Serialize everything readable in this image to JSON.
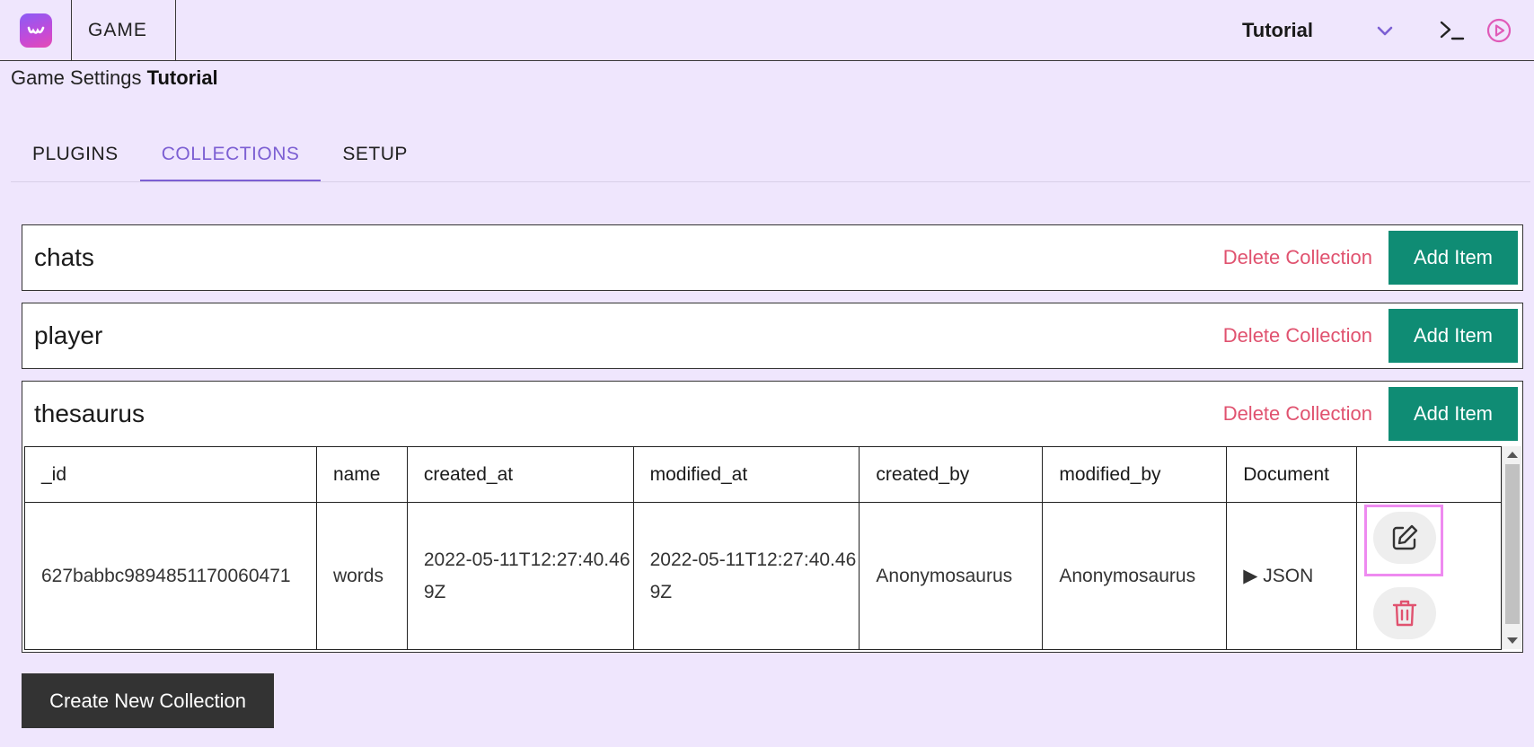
{
  "topbar": {
    "app_label": "GAME",
    "selected_game": "Tutorial"
  },
  "breadcrumb": {
    "prefix": "Game Settings",
    "current": "Tutorial"
  },
  "tabs": [
    {
      "label": "PLUGINS",
      "active": false
    },
    {
      "label": "COLLECTIONS",
      "active": true
    },
    {
      "label": "SETUP",
      "active": false
    }
  ],
  "collections": [
    {
      "name": "chats",
      "delete_label": "Delete Collection",
      "add_label": "Add Item"
    },
    {
      "name": "player",
      "delete_label": "Delete Collection",
      "add_label": "Add Item"
    },
    {
      "name": "thesaurus",
      "delete_label": "Delete Collection",
      "add_label": "Add Item"
    }
  ],
  "table": {
    "headers": [
      "_id",
      "name",
      "created_at",
      "modified_at",
      "created_by",
      "modified_by",
      "Document",
      ""
    ],
    "rows": [
      {
        "_id": "627babbc9894851170060471",
        "name": "words",
        "created_at": "2022-05-11T12:27:40.469Z",
        "modified_at": "2022-05-11T12:27:40.469Z",
        "created_by": "Anonymosaurus",
        "modified_by": "Anonymosaurus",
        "document": "▶ JSON"
      }
    ]
  },
  "create_button_label": "Create New Collection",
  "colors": {
    "background": "#efe6fd",
    "accent": "#7c5fd3",
    "add_button": "#0f8c74",
    "delete_text": "#e0526f",
    "highlight": "#ee8af0"
  },
  "icons": [
    "app-logo-icon",
    "chevron-down-icon",
    "terminal-icon",
    "play-circle-icon",
    "edit-icon",
    "trash-icon"
  ]
}
